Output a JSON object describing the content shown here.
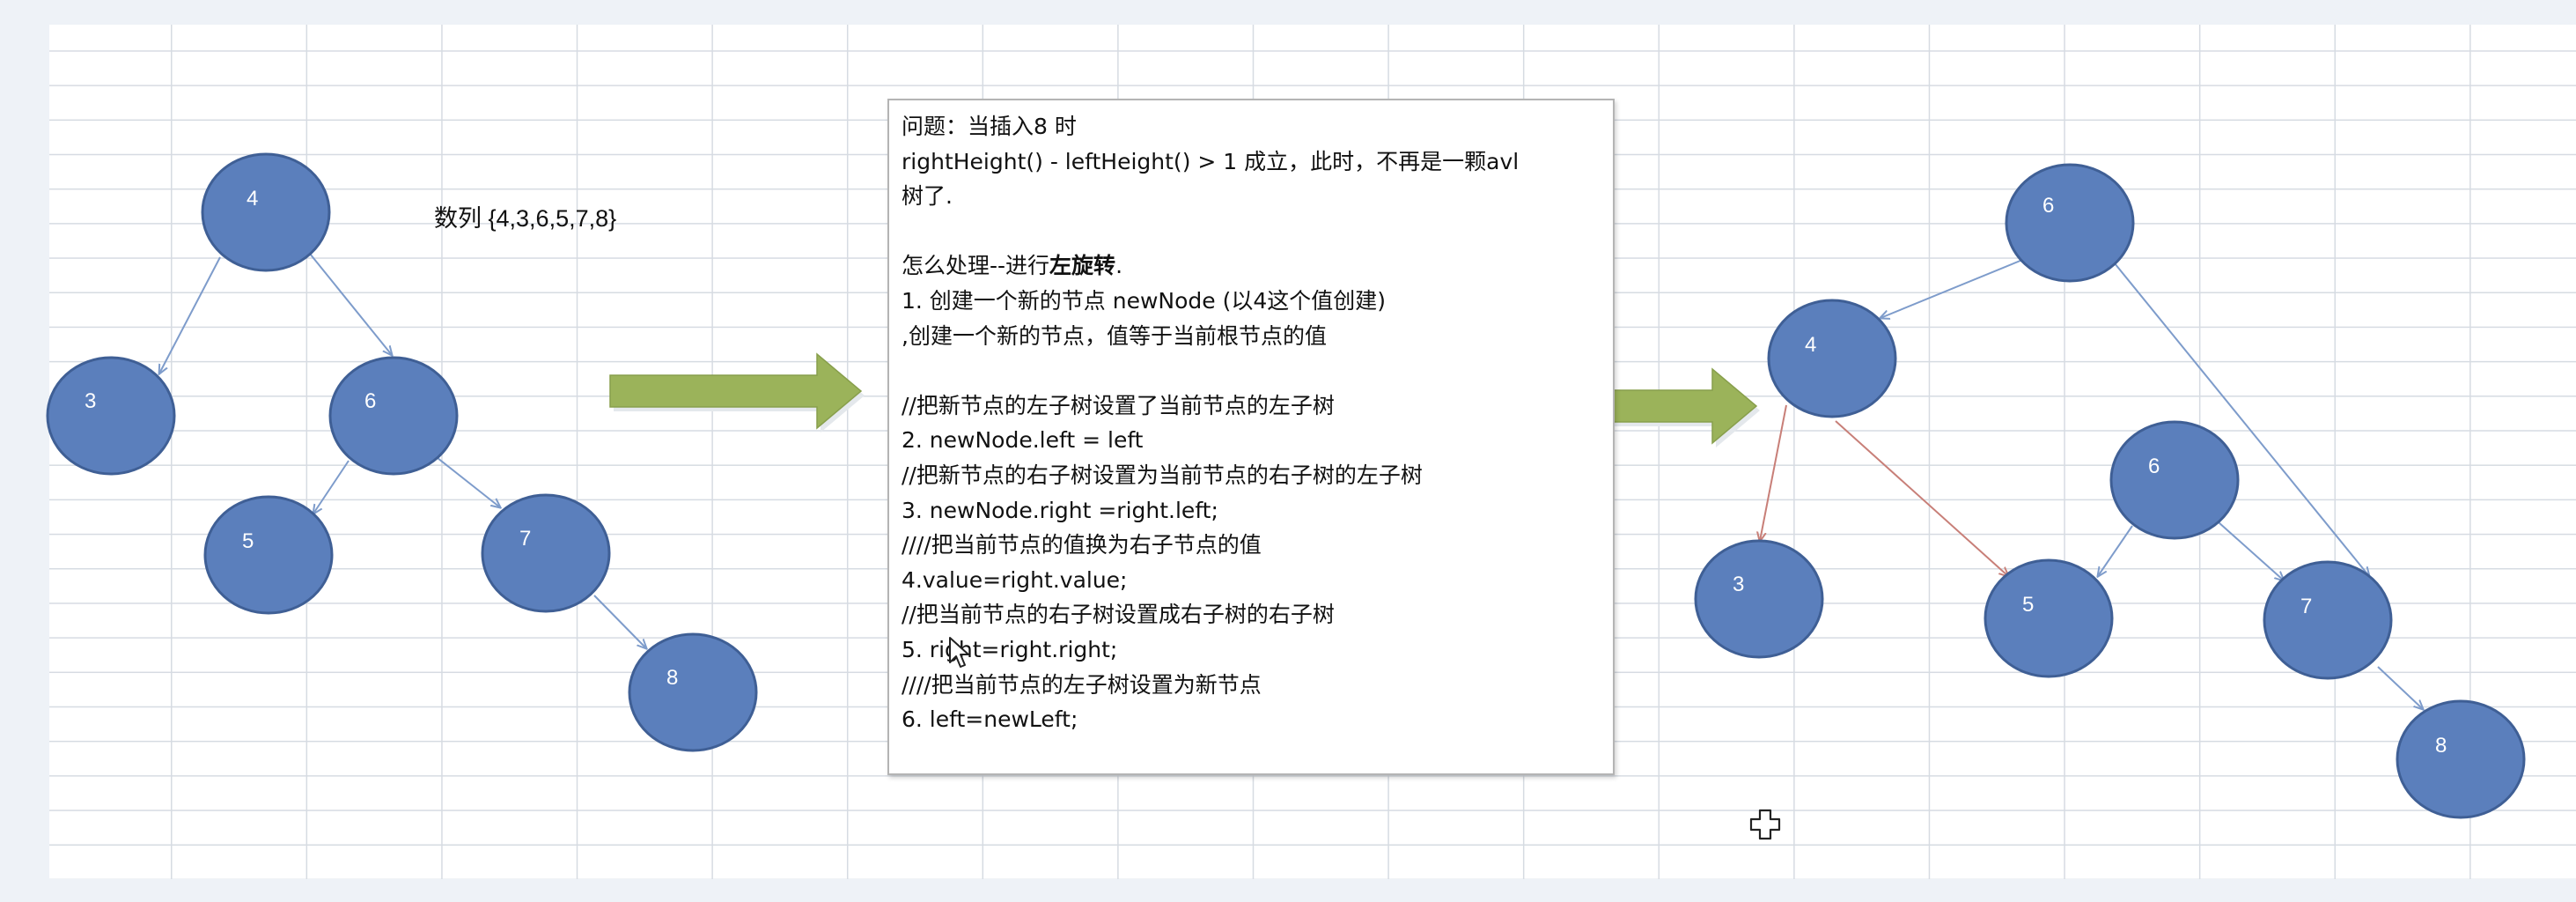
{
  "diagram": {
    "sequence_label": "数列 {4,3,6,5,7,8}",
    "trees": [
      {
        "id": "tree-before",
        "nodes": [
          "4",
          "3",
          "6",
          "5",
          "7",
          "8"
        ],
        "edges": [
          [
            "4",
            "3"
          ],
          [
            "4",
            "6"
          ],
          [
            "6",
            "5"
          ],
          [
            "6",
            "7"
          ],
          [
            "7",
            "8"
          ]
        ]
      },
      {
        "id": "tree-after",
        "nodes": [
          "6",
          "4",
          "3",
          "5",
          "6",
          "7",
          "8"
        ],
        "edges": [
          [
            "6",
            "4"
          ],
          [
            "6",
            "7"
          ],
          [
            "4",
            "3"
          ],
          [
            "4",
            "5"
          ],
          [
            "6",
            "5"
          ],
          [
            "6",
            "7"
          ],
          [
            "7",
            "8"
          ]
        ]
      }
    ],
    "colors": {
      "node_fill": "#5b7fbc",
      "node_stroke": "#3f5f95",
      "edge_blue": "#7e9ccb",
      "edge_red": "#c87f78",
      "arrow_green": "#9bb35a"
    }
  },
  "notes": {
    "lines": [
      "问题：当插入8 时",
      "rightHeight() - leftHeight() > 1 成立，此时，不再是一颗avl",
      "树了.",
      "",
      "",
      "1. 创建一个新的节点 newNode (以4这个值创建)",
      ",创建一个新的节点，值等于当前根节点的值",
      "",
      "//把新节点的左子树设置了当前节点的左子树",
      "2. newNode.left  = left",
      "//把新节点的右子树设置为当前节点的右子树的左子树",
      "3. newNode.right =right.left;",
      "////把当前节点的值换为右子节点的值",
      "4.value=right.value;",
      "//把当前节点的右子树设置成右子树的右子树",
      "5. right=right.right;",
      "////把当前节点的左子树设置为新节点",
      "6. left=newLeft;"
    ],
    "howto_prefix": "怎么处理--进行",
    "howto_bold": "左旋转",
    "howto_suffix": "."
  }
}
